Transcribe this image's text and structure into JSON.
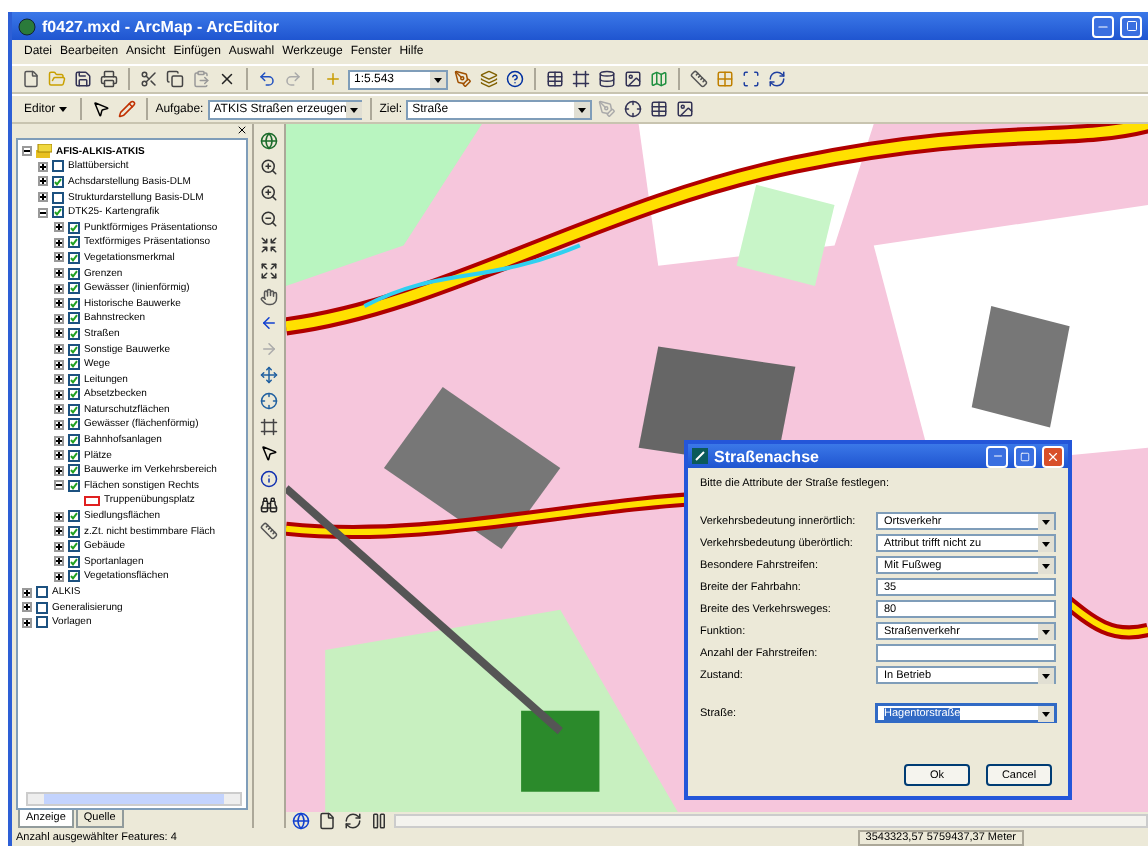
{
  "window": {
    "title": "f0427.mxd - ArcMap - ArcEditor"
  },
  "menu": [
    "Datei",
    "Bearbeiten",
    "Ansicht",
    "Einfügen",
    "Auswahl",
    "Werkzeuge",
    "Fenster",
    "Hilfe"
  ],
  "standard_toolbar": {
    "scale": "1:5.543"
  },
  "editor_toolbar": {
    "editor": "Editor",
    "task_label": "Aufgabe:",
    "task": "ATKIS Straßen erzeugen",
    "target_label": "Ziel:",
    "target": "Straße"
  },
  "toc": {
    "items": [
      {
        "label": "AFIS-ALKIS-ATKIS",
        "kind": "group",
        "expanded": true,
        "children": [
          {
            "label": "Blattübersicht",
            "kind": "layer",
            "checked": false,
            "expanded": false
          },
          {
            "label": "Achsdarstellung Basis-DLM",
            "kind": "layer",
            "checked": true,
            "expanded": false
          },
          {
            "label": "Strukturdarstellung Basis-DLM",
            "kind": "layer",
            "checked": false,
            "expanded": false
          },
          {
            "label": "DTK25- Kartengrafik",
            "kind": "layer",
            "checked": true,
            "expanded": true,
            "children": [
              {
                "label": "Punktförmiges Präsentationso",
                "kind": "layer",
                "checked": true,
                "expanded": false
              },
              {
                "label": "Textförmiges Präsentationso",
                "kind": "layer",
                "checked": true,
                "expanded": false
              },
              {
                "label": "Vegetationsmerkmal",
                "kind": "layer",
                "checked": true,
                "expanded": false
              },
              {
                "label": "Grenzen",
                "kind": "layer",
                "checked": true,
                "expanded": false
              },
              {
                "label": "Gewässer (linienförmig)",
                "kind": "layer",
                "checked": true,
                "expanded": false
              },
              {
                "label": "Historische Bauwerke",
                "kind": "layer",
                "checked": true,
                "expanded": false
              },
              {
                "label": "Bahnstrecken",
                "kind": "layer",
                "checked": true,
                "expanded": false
              },
              {
                "label": "Straßen",
                "kind": "layer",
                "checked": true,
                "expanded": false
              },
              {
                "label": "Sonstige Bauwerke",
                "kind": "layer",
                "checked": true,
                "expanded": false
              },
              {
                "label": "Wege",
                "kind": "layer",
                "checked": true,
                "expanded": false
              },
              {
                "label": "Leitungen",
                "kind": "layer",
                "checked": true,
                "expanded": false
              },
              {
                "label": "Absetzbecken",
                "kind": "layer",
                "checked": true,
                "expanded": false
              },
              {
                "label": "Naturschutzflächen",
                "kind": "layer",
                "checked": true,
                "expanded": false
              },
              {
                "label": "Gewässer (flächenförmig)",
                "kind": "layer",
                "checked": true,
                "expanded": false
              },
              {
                "label": "Bahnhofsanlagen",
                "kind": "layer",
                "checked": true,
                "expanded": false
              },
              {
                "label": "Plätze",
                "kind": "layer",
                "checked": true,
                "expanded": false
              },
              {
                "label": "Bauwerke im Verkehrsbereich",
                "kind": "layer",
                "checked": true,
                "expanded": false
              },
              {
                "label": "Flächen sonstigen Rechts",
                "kind": "layer",
                "checked": true,
                "expanded": true,
                "children": [
                  {
                    "label": "Truppenübungsplatz",
                    "kind": "legend",
                    "color": "#e02020"
                  }
                ]
              },
              {
                "label": "Siedlungsflächen",
                "kind": "layer",
                "checked": true,
                "expanded": false
              },
              {
                "label": "z.Zt. nicht bestimmbare Fläch",
                "kind": "layer",
                "checked": true,
                "expanded": false
              },
              {
                "label": "Gebäude",
                "kind": "layer",
                "checked": true,
                "expanded": false
              },
              {
                "label": "Sportanlagen",
                "kind": "layer",
                "checked": true,
                "expanded": false
              },
              {
                "label": "Vegetationsflächen",
                "kind": "layer",
                "checked": true,
                "expanded": false
              }
            ]
          }
        ]
      },
      {
        "label": "ALKIS",
        "kind": "layer",
        "checked": false,
        "expanded": false
      },
      {
        "label": "Generalisierung",
        "kind": "layer",
        "checked": false,
        "expanded": false
      },
      {
        "label": "Vorlagen",
        "kind": "layer",
        "checked": false,
        "expanded": false
      }
    ]
  },
  "toc_tabs": [
    {
      "label": "Anzeige",
      "selected": true
    },
    {
      "label": "Quelle",
      "selected": false
    }
  ],
  "dialog": {
    "title": "Straßenachse",
    "prompt": "Bitte die Attribute der Straße festlegen:",
    "fields": [
      {
        "label": "Verkehrsbedeutung innerörtlich:",
        "kind": "select",
        "value": "Ortsverkehr",
        "highlighted": false
      },
      {
        "label": "Verkehrsbedeutung überörtlich:",
        "kind": "select",
        "value": "Attribut trifft nicht zu",
        "highlighted": false
      },
      {
        "label": "Besondere Fahrstreifen:",
        "kind": "select",
        "value": "Mit Fußweg",
        "highlighted": false
      },
      {
        "label": "Breite der Fahrbahn:",
        "kind": "input",
        "value": "35",
        "highlighted": false
      },
      {
        "label": "Breite des Verkehrsweges:",
        "kind": "input",
        "value": "80",
        "highlighted": false
      },
      {
        "label": "Funktion:",
        "kind": "select",
        "value": "Straßenverkehr",
        "highlighted": false
      },
      {
        "label": "Anzahl der Fahrstreifen:",
        "kind": "input",
        "highlighted": false
      },
      {
        "label": "Zustand:",
        "kind": "select",
        "value": "In Betrieb",
        "highlighted": false
      },
      {
        "label": "Straße:",
        "kind": "select",
        "value": "Hagentorstraße",
        "highlighted": true
      }
    ],
    "buttons": [
      "Ok",
      "Cancel"
    ]
  },
  "status_bar": {
    "message": "Anzahl ausgewählter Features: 4",
    "coordinates": "3543323,57  5759437,37 Meter"
  }
}
